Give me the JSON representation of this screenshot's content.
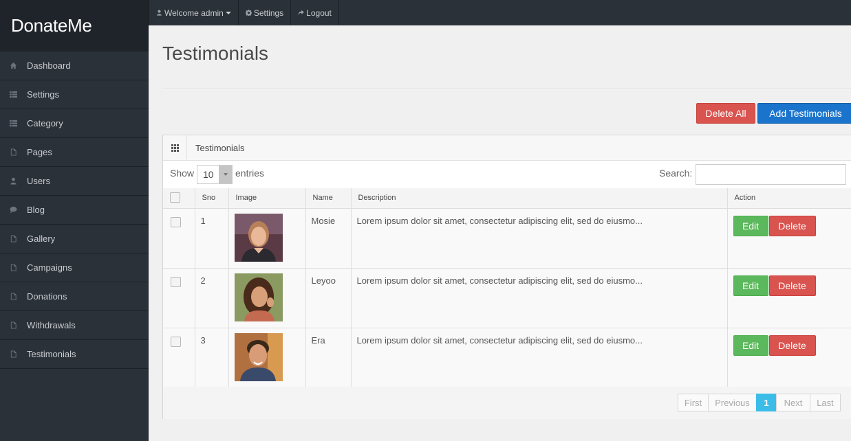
{
  "brand": "DonateMe",
  "sidebar": {
    "items": [
      {
        "label": "Dashboard",
        "icon": "home-icon"
      },
      {
        "label": "Settings",
        "icon": "list-icon"
      },
      {
        "label": "Category",
        "icon": "list-icon"
      },
      {
        "label": "Pages",
        "icon": "file-icon"
      },
      {
        "label": "Users",
        "icon": "user-icon"
      },
      {
        "label": "Blog",
        "icon": "comment-icon"
      },
      {
        "label": "Gallery",
        "icon": "file-icon"
      },
      {
        "label": "Campaigns",
        "icon": "file-icon"
      },
      {
        "label": "Donations",
        "icon": "file-icon"
      },
      {
        "label": "Withdrawals",
        "icon": "file-icon"
      },
      {
        "label": "Testimonials",
        "icon": "file-icon"
      }
    ]
  },
  "topbar": {
    "welcome": "Welcome admin",
    "settings": "Settings",
    "logout": "Logout"
  },
  "page": {
    "title": "Testimonials",
    "delete_all": "Delete All",
    "add": "Add Testimonials"
  },
  "panel": {
    "title": "Testimonials",
    "show_label": "Show",
    "entries_value": "10",
    "entries_label": "entries",
    "search_label": "Search:",
    "search_value": ""
  },
  "table": {
    "columns": [
      "Sno",
      "Image",
      "Name",
      "Description",
      "Action"
    ],
    "rows": [
      {
        "sno": "1",
        "name": "Mosie",
        "description": "Lorem ipsum dolor sit amet, consectetur adipiscing elit, sed do eiusmo...",
        "edit": "Edit",
        "delete": "Delete"
      },
      {
        "sno": "2",
        "name": "Leyoo",
        "description": "Lorem ipsum dolor sit amet, consectetur adipiscing elit, sed do eiusmo...",
        "edit": "Edit",
        "delete": "Delete"
      },
      {
        "sno": "3",
        "name": "Era",
        "description": "Lorem ipsum dolor sit amet, consectetur adipiscing elit, sed do eiusmo...",
        "edit": "Edit",
        "delete": "Delete"
      }
    ]
  },
  "pagination": {
    "first": "First",
    "previous": "Previous",
    "current": "1",
    "next": "Next",
    "last": "Last"
  },
  "colors": {
    "sidebar_bg": "#2b3139",
    "brand_bg": "#1f242a",
    "danger": "#d9534f",
    "primary": "#1a74cc",
    "success": "#5cb85c",
    "active_page": "#3bbde8"
  }
}
